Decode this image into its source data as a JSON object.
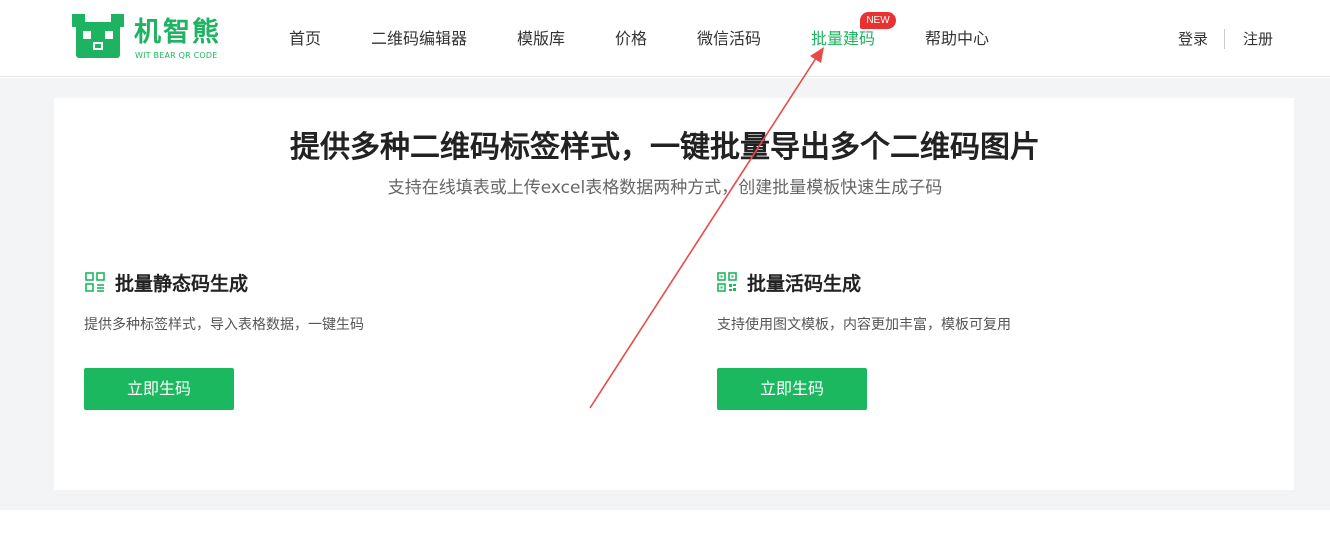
{
  "brand": {
    "name": "机智熊",
    "tagline": "WIT BEAR QR CODE",
    "color": "#1eb361"
  },
  "nav": {
    "items": [
      {
        "label": "首页"
      },
      {
        "label": "二维码编辑器"
      },
      {
        "label": "模版库"
      },
      {
        "label": "价格"
      },
      {
        "label": "微信活码"
      },
      {
        "label": "批量建码",
        "active": true
      },
      {
        "label": "帮助中心"
      }
    ],
    "new_badge": "NEW"
  },
  "auth": {
    "login": "登录",
    "register": "注册"
  },
  "hero": {
    "title": "提供多种二维码标签样式，一键批量导出多个二维码图片",
    "subtitle": "支持在线填表或上传excel表格数据两种方式，创建批量模板快速生成子码"
  },
  "features": [
    {
      "icon": "qr-list-icon",
      "title": "批量静态码生成",
      "description": "提供多种标签样式，导入表格数据，一键生码",
      "button": "立即生码"
    },
    {
      "icon": "qr-code-icon",
      "title": "批量活码生成",
      "description": "支持使用图文模板，内容更加丰富，模板可复用",
      "button": "立即生码"
    }
  ],
  "colors": {
    "accent": "#1cb85f",
    "badge": "#e83232",
    "annotation_arrow": "#e84a4a"
  }
}
